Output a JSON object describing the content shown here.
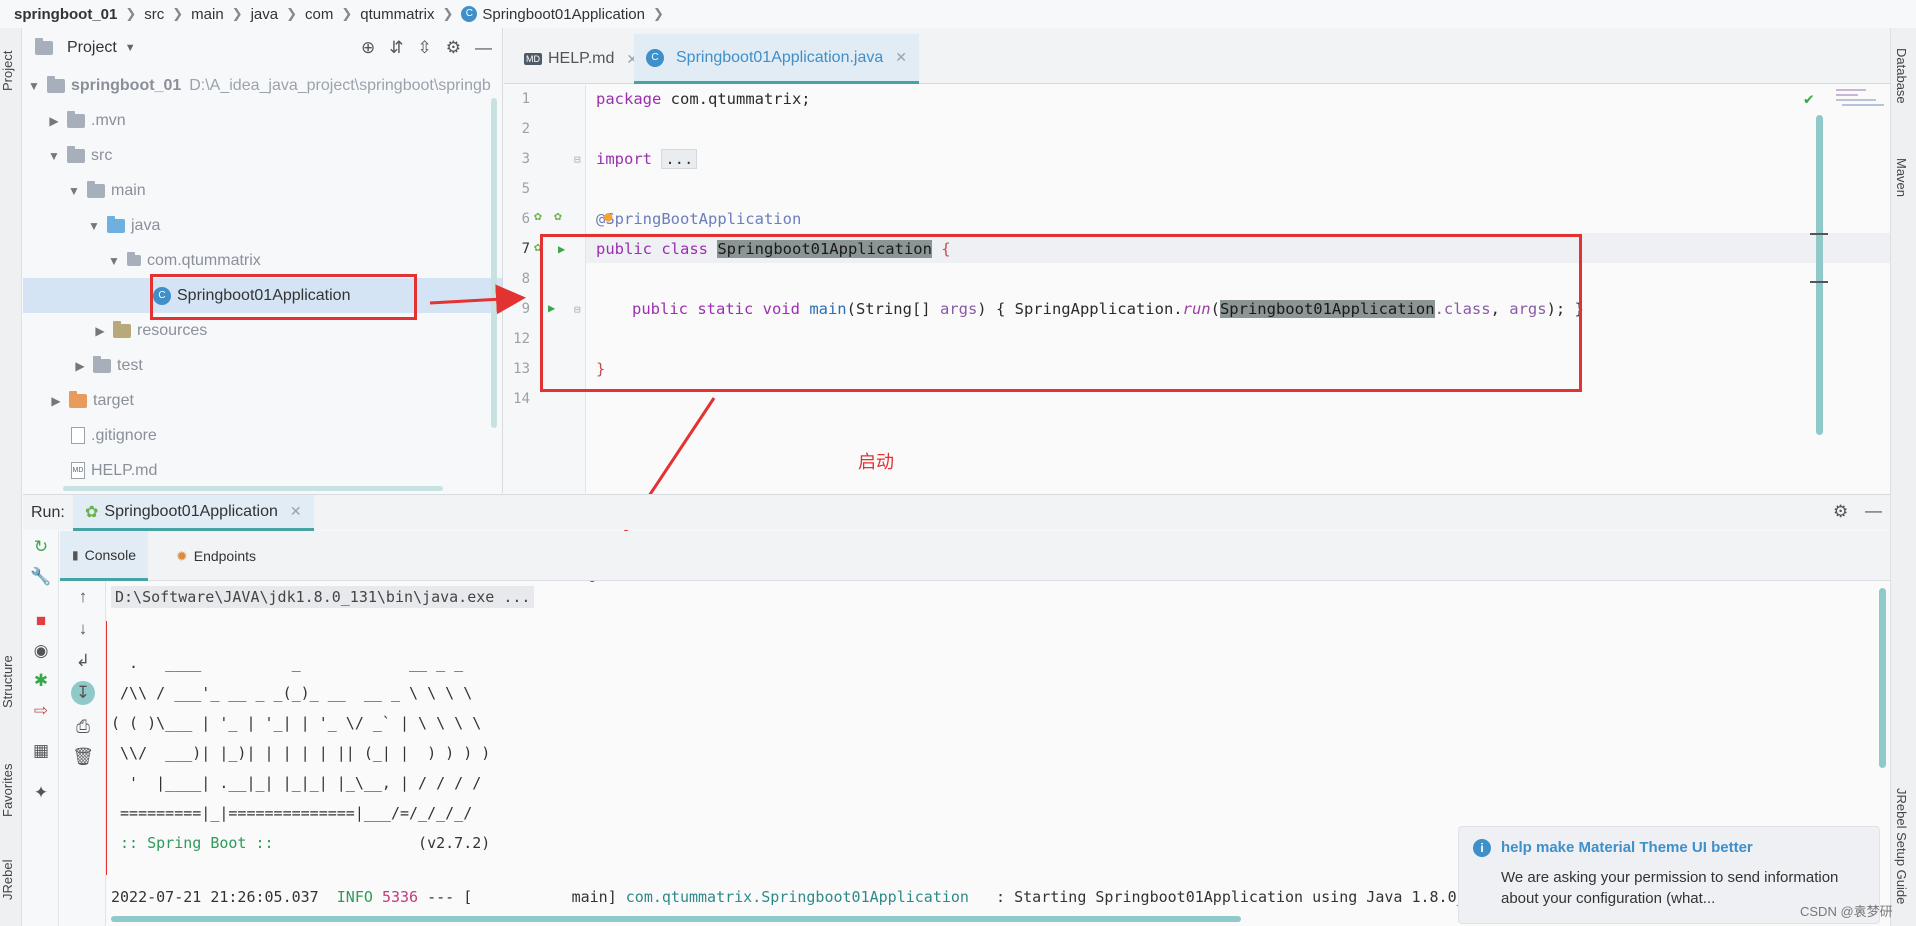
{
  "breadcrumb": {
    "items": [
      "springboot_01",
      "src",
      "main",
      "java",
      "com",
      "qtummatrix",
      "Springboot01Application"
    ]
  },
  "left_strip": {
    "project": "Project",
    "structure": "Structure",
    "favorites": "Favorites",
    "jrebel": "JRebel"
  },
  "right_strip": {
    "database": "Database",
    "maven": "Maven",
    "jrebel_setup": "JRebel Setup Guide"
  },
  "project_panel": {
    "title": "Project",
    "root_name": "springboot_01",
    "root_path": "D:\\A_idea_java_project\\springboot\\springb",
    "items": [
      ".mvn",
      "src",
      "main",
      "java",
      "com.qtummatrix",
      "Springboot01Application",
      "resources",
      "test",
      "target",
      ".gitignore",
      "HELP.md"
    ]
  },
  "editor": {
    "tabs": [
      {
        "label": "HELP.md"
      },
      {
        "label": "Springboot01Application.java"
      }
    ],
    "line_numbers": [
      "1",
      "2",
      "3",
      "5",
      "6",
      "7",
      "8",
      "9",
      "12",
      "13",
      "14"
    ],
    "code": {
      "l1_kw": "package",
      "l1_rest": " com.qtummatrix;",
      "l3_kw": "import",
      "l3_fold": "...",
      "l6_ann": "@SpringBootApplication",
      "l7_kw": "public class ",
      "l7_cls": "Springboot01Application",
      "l7_brace": " {",
      "l9_kw": "public static void ",
      "l9_method": "main",
      "l9_params_a": "(String[] ",
      "l9_args": "args",
      "l9_params_b": ") ",
      "l9_body_open": "{ SpringApplication.",
      "l9_run": "run",
      "l9_paren": "(",
      "l9_cls": "Springboot01Application",
      "l9_class_kw": ".class",
      "l9_comma": ", ",
      "l9_args2": "args",
      "l9_end": "); }",
      "l13_brace": "}"
    }
  },
  "annotation": {
    "text": "启动"
  },
  "run_panel": {
    "label": "Run:",
    "tab_label": "Springboot01Application",
    "console_tab": "Console",
    "endpoints_tab": "Endpoints"
  },
  "console": {
    "command": "D:\\Software\\JAVA\\jdk1.8.0_131\\bin\\java.exe ...",
    "banner": [
      "  .   ____          _            __ _ _",
      " /\\\\ / ___'_ __ _ _(_)_ __  __ _ \\ \\ \\ \\",
      "( ( )\\___ | '_ | '_| | '_ \\/ _` | \\ \\ \\ \\",
      " \\\\/  ___)| |_)| | | | | || (_| |  ) ) ) )",
      "  '  |____| .__|_| |_|_| |_\\__, | / / / /",
      " =========|_|==============|___/=/_/_/_/"
    ],
    "spring_boot_label": " :: Spring Boot :: ",
    "spring_boot_version": "               (v2.7.2)",
    "log_timestamp": "2022-07-21 21:26:05.037",
    "log_level": "INFO",
    "log_pid": "5336",
    "log_sep": " --- [           main] ",
    "log_logger": "com.qtummatrix.Springboot01Application",
    "log_message": "   : Starting Springboot01Application using Java 1.8.0_"
  },
  "notification": {
    "title": "help make Material Theme UI better",
    "body": "We are asking your permission to send information about your configuration (what..."
  },
  "watermark": "CSDN @袁梦研",
  "colors": {
    "accent": "#3f8fc9",
    "annotation_red": "#e23232",
    "active_tab_underline": "#46a3a3",
    "keyword": "#9b2fb0",
    "selection": "#d5e4f5"
  }
}
